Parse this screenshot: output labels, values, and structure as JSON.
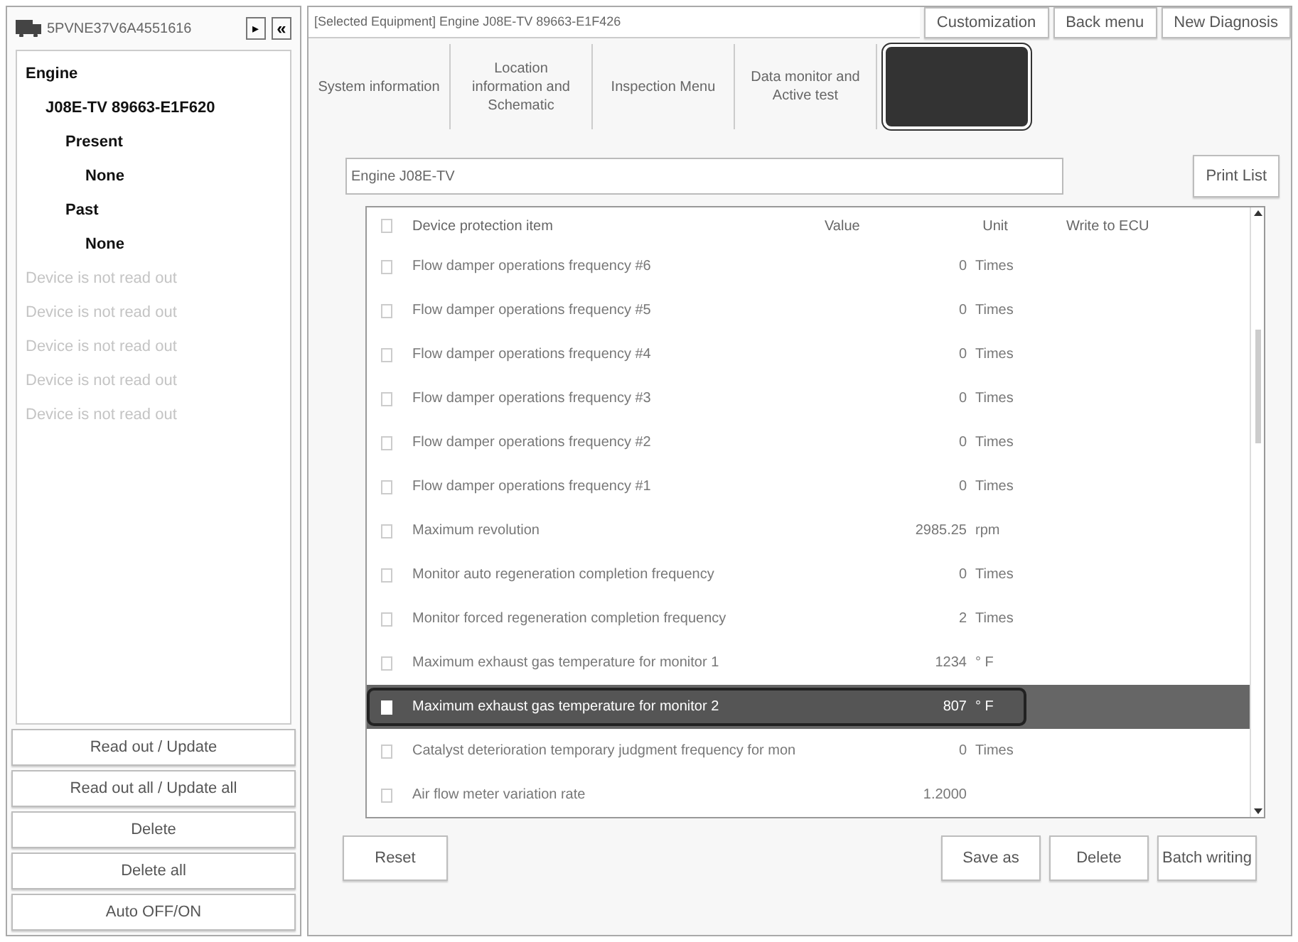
{
  "vehicle": {
    "vin": "5PVNE37V6A4551616",
    "expand_button": "▸",
    "collapse_button": "«"
  },
  "tree": [
    {
      "label": "Engine",
      "enabled": true,
      "children": [
        {
          "label": "J08E-TV 89663-E1F620",
          "enabled": true,
          "children": [
            {
              "label": "Present",
              "enabled": true,
              "children": [
                {
                  "label": "None",
                  "enabled": true
                }
              ]
            },
            {
              "label": "Past",
              "enabled": true,
              "children": [
                {
                  "label": "None",
                  "enabled": true
                }
              ]
            }
          ]
        }
      ]
    },
    {
      "label": "Device is not read out",
      "enabled": false
    },
    {
      "label": "Device is not read out",
      "enabled": false
    },
    {
      "label": "Device is not read out",
      "enabled": false
    },
    {
      "label": "Device is not read out",
      "enabled": false
    },
    {
      "label": "Device is not read out",
      "enabled": false
    }
  ],
  "side_buttons": [
    "Read out / Update",
    "Read out all / Update all",
    "Delete",
    "Delete all",
    "Auto OFF/ON"
  ],
  "selected_equipment": "[Selected Equipment] Engine J08E-TV 89663-E1F426",
  "top_buttons": [
    "Customization",
    "Back menu",
    "New Diagnosis"
  ],
  "tabs": [
    {
      "label": "System information",
      "kind": "text",
      "selected": false
    },
    {
      "label": "Location information and Schematic",
      "kind": "text",
      "selected": false
    },
    {
      "label": "Inspection Menu",
      "kind": "text",
      "selected": false
    },
    {
      "label": "Data monitor and Active test",
      "kind": "text",
      "selected": false
    },
    {
      "kind": "redacted",
      "selected": true
    }
  ],
  "group_field": "Engine J08E-TV",
  "print_button": "Print List",
  "table": {
    "all_checked": false,
    "columns": [
      "Device protection item",
      "Value",
      "Unit",
      "Write to ECU"
    ],
    "rows": [
      {
        "item": "Flow damper operations frequency #6",
        "value": "0",
        "unit": "Times",
        "selected": false
      },
      {
        "item": "Flow damper operations frequency #5",
        "value": "0",
        "unit": "Times",
        "selected": false
      },
      {
        "item": "Flow damper operations frequency #4",
        "value": "0",
        "unit": "Times",
        "selected": false
      },
      {
        "item": "Flow damper operations frequency #3",
        "value": "0",
        "unit": "Times",
        "selected": false
      },
      {
        "item": "Flow damper operations frequency #2",
        "value": "0",
        "unit": "Times",
        "selected": false
      },
      {
        "item": "Flow damper operations frequency #1",
        "value": "0",
        "unit": "Times",
        "selected": false
      },
      {
        "item": "Maximum revolution",
        "value": "2985.25",
        "unit": "rpm",
        "selected": false
      },
      {
        "item": "Monitor auto regeneration completion frequency",
        "value": "0",
        "unit": "Times",
        "selected": false
      },
      {
        "item": "Monitor forced regeneration completion frequency",
        "value": "2",
        "unit": "Times",
        "selected": false
      },
      {
        "item": "Maximum exhaust gas temperature for monitor 1",
        "value": "1234",
        "unit": "° F",
        "selected": false
      },
      {
        "item": "Maximum exhaust gas temperature for monitor 2",
        "value": "807",
        "unit": "° F",
        "selected": true
      },
      {
        "item": "Catalyst deterioration temporary judgment frequency for mon",
        "value": "0",
        "unit": "Times",
        "selected": false
      },
      {
        "item": "Air flow meter variation rate",
        "value": "1.2000",
        "selected": false
      }
    ]
  },
  "bottom_left_button": "Reset",
  "bottom_buttons": [
    "Save as",
    "Delete",
    "Batch writing"
  ]
}
